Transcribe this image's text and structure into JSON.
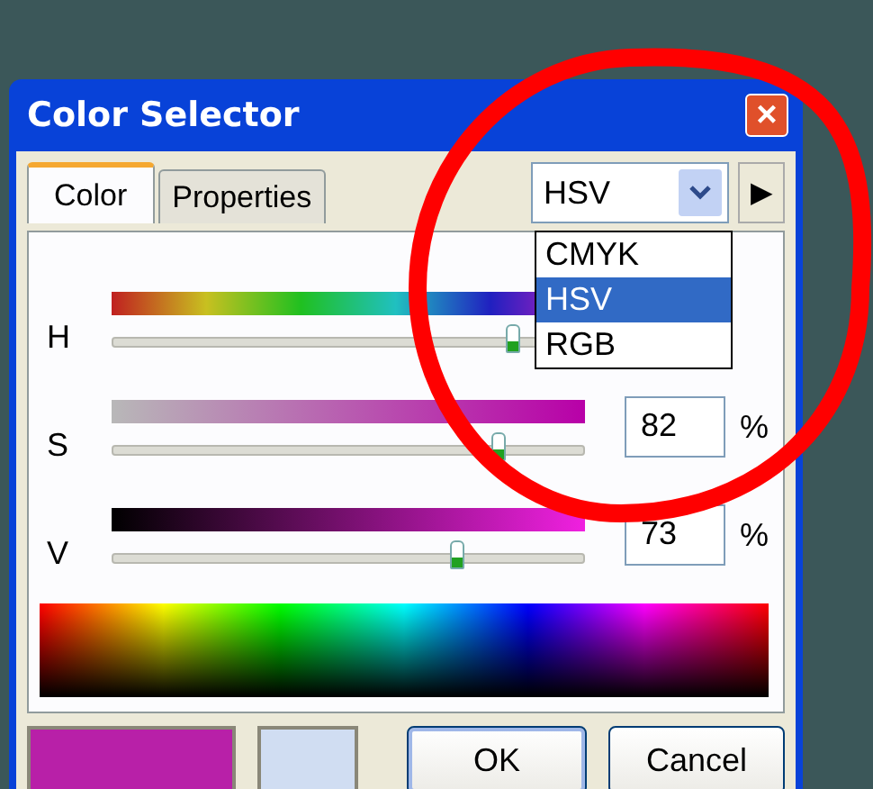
{
  "window": {
    "title": "Color Selector",
    "close": "×"
  },
  "tabs": [
    {
      "label": "Color",
      "selected": true
    },
    {
      "label": "Properties",
      "selected": false
    }
  ],
  "mode_combo": {
    "value": "HSV",
    "arrow": "▶",
    "expanded": true,
    "options": [
      {
        "label": "CMYK",
        "selected": false
      },
      {
        "label": "HSV",
        "selected": true
      },
      {
        "label": "RGB",
        "selected": false
      }
    ]
  },
  "channels": [
    {
      "kind": "hue",
      "label": "H",
      "level": 0.85
    },
    {
      "kind": "saturation",
      "label": "S",
      "level": 0.82,
      "value": "82",
      "unit": "%"
    },
    {
      "kind": "value",
      "label": "V",
      "level": 0.73,
      "value": "73",
      "unit": "%"
    }
  ],
  "swatches": [
    {
      "color": "#b820a8"
    },
    {
      "color": "#d0ddf2"
    }
  ],
  "buttons": [
    "OK",
    "Cancel"
  ],
  "annotation": {
    "kind": "circle"
  }
}
